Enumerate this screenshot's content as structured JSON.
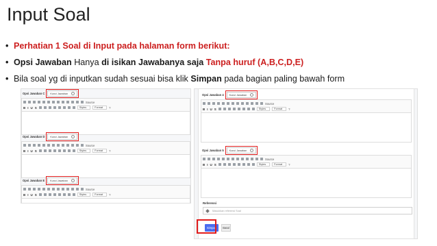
{
  "slide": {
    "title": "Input Soal",
    "bullets": {
      "b1": "Perhatian 1 Soal di Input pada halaman form berikut:",
      "b2_a": "Opsi Jawaban",
      "b2_b": " Hanya ",
      "b2_c": "di isikan Jawabanya saja",
      "b2_d": " ",
      "b2_e": "Tanpa huruf (A,B,C,D,E)",
      "b3_a": "Bila soal yg di inputkan sudah sesuai bisa klik ",
      "b3_b": "Simpan",
      "b3_c": " pada bagian paling bawah form"
    }
  },
  "form": {
    "left_editors": [
      {
        "label": "Opsi Jawaban C",
        "select": "Kunci Jawaban"
      },
      {
        "label": "Opsi Jawaban D",
        "select": "Kunci Jawaban"
      },
      {
        "label": "Opsi Jawaban E",
        "select": "Kunci Jawaban"
      }
    ],
    "right_editors": [
      {
        "label": "Opsi Jawaban 4",
        "select": "Kunci Jawaban"
      },
      {
        "label": "Opsi Jawaban 5",
        "select": "Kunci Jawaban"
      }
    ],
    "toolbar": {
      "source": "Source",
      "styles": "Styles",
      "format": "Format",
      "help": "?"
    },
    "referensi": {
      "label": "Referensi",
      "placeholder": "Masukkan referensi Soal"
    },
    "buttons": {
      "simpan": "Simpan",
      "batal": "Batal"
    }
  },
  "colors": {
    "highlight": "#e11b1b",
    "accent_text": "#cc1f1f",
    "primary_button": "#4a6cf0"
  }
}
